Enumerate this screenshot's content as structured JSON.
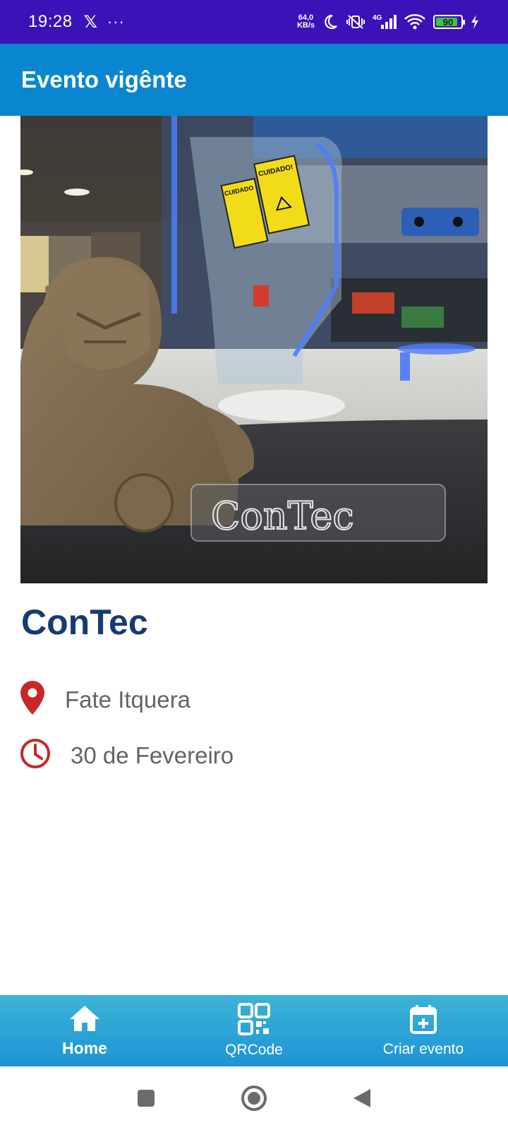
{
  "status_bar": {
    "time": "19:28",
    "x_icon": "x-logo-icon",
    "more": "···",
    "net_speed_value": "64,0",
    "net_speed_unit": "KB/s",
    "network": "4G",
    "battery": "90",
    "battery_level": 0.9,
    "background": "#3a12b8"
  },
  "app_bar": {
    "title": "Evento vigênte",
    "background": "#0a86d0"
  },
  "event": {
    "image_icon": "event-photo",
    "image_sign_1": "CUIDADO!",
    "image_sign_2": "CUIDADO",
    "image_logo_text": "ConTec",
    "name": "ConTec",
    "location": "Fate Itquera",
    "date": "30 de Fevereiro",
    "name_color": "#163b73",
    "icon_color": "#c62828"
  },
  "bottom_nav": {
    "items": [
      {
        "label": "Home",
        "icon": "home-icon",
        "active": true
      },
      {
        "label": "QRCode",
        "icon": "qr-code-icon",
        "active": false
      },
      {
        "label": "Criar evento",
        "icon": "calendar-add-icon",
        "active": false
      }
    ]
  },
  "system_nav": {
    "icons": [
      "recents-square-icon",
      "home-circle-icon",
      "back-triangle-icon"
    ]
  }
}
